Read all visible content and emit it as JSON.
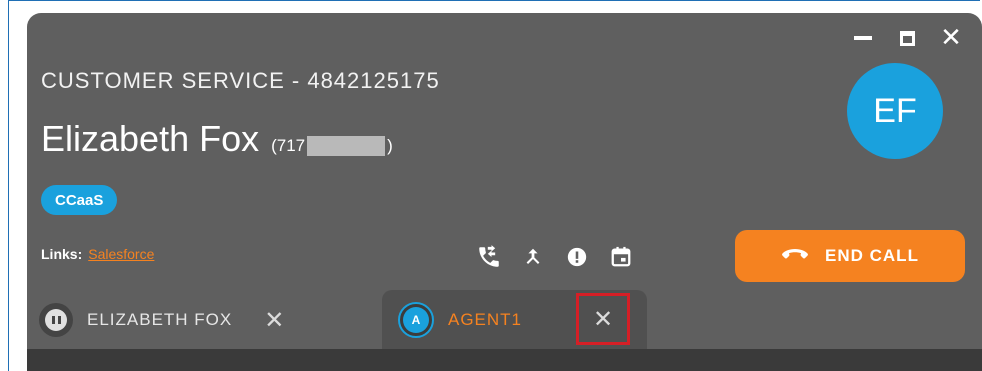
{
  "window": {
    "minimize_icon": "minimize-icon",
    "maximize_icon": "maximize-icon",
    "close_icon": "close-icon",
    "close_glyph": "✕"
  },
  "call": {
    "queue_line": "CUSTOMER SERVICE - 4842125175",
    "caller_name": "Elizabeth Fox",
    "caller_phone_prefix": "(717",
    "caller_phone_suffix": ")",
    "avatar_initials": "EF",
    "badge": "CCaaS"
  },
  "links": {
    "label": "Links:",
    "items": [
      "Salesforce"
    ]
  },
  "actions": {
    "icons": [
      "transfer-call-icon",
      "merge-call-icon",
      "alert-icon",
      "calendar-icon"
    ],
    "end_call_label": "END CALL",
    "end_call_icon": "hang-up-icon"
  },
  "tabs": [
    {
      "label": "ELIZABETH FOX",
      "icon": "pause-icon",
      "close_glyph": "✕"
    },
    {
      "label": "AGENT1",
      "avatar_letter": "A",
      "close_glyph": "✕",
      "active": true
    }
  ],
  "colors": {
    "panel_bg": "#5f5f5f",
    "accent_blue": "#1aa1dd",
    "accent_orange": "#f58220",
    "highlight_red": "#d61f26"
  }
}
